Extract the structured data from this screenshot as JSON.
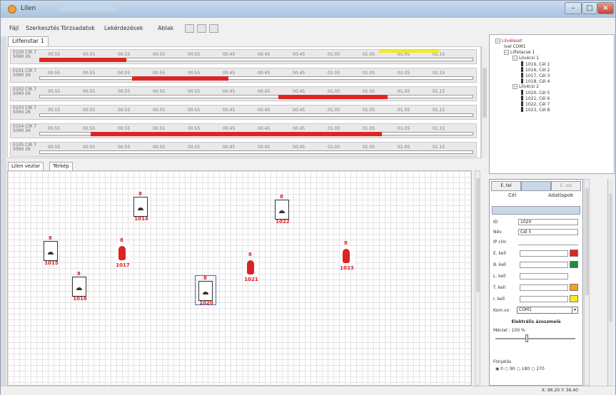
{
  "window": {
    "title": "Lilen"
  },
  "menu": [
    "Fájl",
    "Szerkesztés",
    "Törzsadatok",
    "Lekérdezések",
    "Ablak"
  ],
  "top_tab": "Lilfenstar 1",
  "timeline": {
    "rows": [
      {
        "label": "0100 CIR 7\n5090 26",
        "ticks": [
          "00.55",
          "00.55",
          "00.55",
          "00.55",
          "00.55",
          "00.45",
          "00.45",
          "00.45",
          "01.05",
          "01.05",
          "01.05",
          "01.15"
        ]
      },
      {
        "label": "0101 CIR 7\n5090 26",
        "ticks": [
          "00.55",
          "00.55",
          "00.55",
          "00.55",
          "00.55",
          "00.45",
          "00.45",
          "00.45",
          "01.05",
          "01.05",
          "01.05",
          "01.15"
        ]
      },
      {
        "label": "0102 CIR 7\n5090 26",
        "ticks": [
          "00.55",
          "00.55",
          "00.55",
          "00.55",
          "00.55",
          "00.45",
          "00.45",
          "00.45",
          "01.05",
          "01.05",
          "01.05",
          "01.15"
        ]
      },
      {
        "label": "0103 CIR 7\n5090 26",
        "ticks": [
          "00.55",
          "00.55",
          "00.55",
          "00.55",
          "00.55",
          "00.45",
          "00.45",
          "00.45",
          "01.05",
          "01.05",
          "01.05",
          "01.15"
        ]
      },
      {
        "label": "0104 CIR 7\n5090 26",
        "ticks": [
          "00.55",
          "00.55",
          "00.55",
          "00.55",
          "00.55",
          "00.45",
          "00.45",
          "00.45",
          "01.05",
          "01.05",
          "01.05",
          "01.15"
        ]
      },
      {
        "label": "0105 CIR 7\n5090 26",
        "ticks": [
          "00.55",
          "00.55",
          "00.55",
          "00.55",
          "00.55",
          "00.45",
          "00.45",
          "00.45",
          "01.05",
          "01.05",
          "01.05",
          "01.15"
        ]
      }
    ]
  },
  "middle_tabs": [
    "Lilen vezlar",
    "Térkép"
  ],
  "tree": {
    "nodes": [
      {
        "text": "Lilvéleset",
        "level": 0,
        "type": "root"
      },
      {
        "text": "Ivel COM1",
        "level": 1,
        "type": "leaf"
      },
      {
        "text": "Lilfetacsé 1",
        "level": 1,
        "type": "folder"
      },
      {
        "text": "Lövécsi 1",
        "level": 2,
        "type": "folder"
      },
      {
        "text": "1016, Cél 1",
        "level": 3,
        "type": "pin"
      },
      {
        "text": "1016, Cél 2",
        "level": 3,
        "type": "pin"
      },
      {
        "text": "1017, Cél 3",
        "level": 3,
        "type": "pin"
      },
      {
        "text": "1018, Cél 4",
        "level": 3,
        "type": "pin"
      },
      {
        "text": "Lövécsi 2",
        "level": 2,
        "type": "folder"
      },
      {
        "text": "1020, Cél 5",
        "level": 3,
        "type": "pin"
      },
      {
        "text": "1021, Cél 6",
        "level": 3,
        "type": "pin"
      },
      {
        "text": "1022, Cél 7",
        "level": 3,
        "type": "pin"
      },
      {
        "text": "1023, Cél 8",
        "level": 3,
        "type": "pin"
      }
    ]
  },
  "sensors": [
    {
      "num": "1014",
      "kind": "box"
    },
    {
      "num": "1022",
      "kind": "box"
    },
    {
      "num": "1015",
      "kind": "box"
    },
    {
      "num": "1017",
      "kind": "figure"
    },
    {
      "num": "1021",
      "kind": "figure"
    },
    {
      "num": "1023",
      "kind": "figure"
    },
    {
      "num": "1016",
      "kind": "box"
    },
    {
      "num": "1020",
      "kind": "box"
    }
  ],
  "props": {
    "tabs": [
      "E. tel",
      "",
      "E. ast"
    ],
    "subtabs": [
      "Cél",
      "Adatlapok"
    ],
    "fields": [
      {
        "label": "ID",
        "value": "1020"
      },
      {
        "label": "Név",
        "value": "Cél 5"
      },
      {
        "label": "IP cím",
        "value": ""
      }
    ],
    "color_fields": [
      {
        "label": "E. kell",
        "color": "#e02424"
      },
      {
        "label": "B. kell",
        "color": "#1e8c3a"
      },
      {
        "label": "L. kell",
        "color": ""
      },
      {
        "label": "T. kell",
        "color": "#f2a020"
      },
      {
        "label": "I. kell",
        "color": "#f2ea2a"
      }
    ],
    "port_label": "Kom.vo",
    "port_value": "COM1",
    "section_title": "Elektrális ázoszmelé",
    "slider_label": "Mérzel : 100 %",
    "footer_label": "Fonjatás",
    "radio_options": [
      "0",
      "90",
      "180",
      "270"
    ]
  },
  "status": {
    "coords": "X: 96.20 Y: 36.40"
  }
}
